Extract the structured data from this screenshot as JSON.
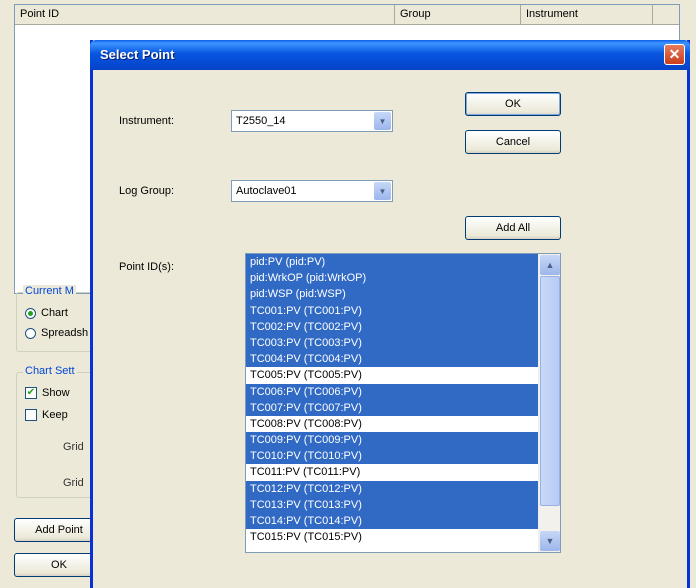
{
  "background": {
    "list_columns": [
      "Point ID",
      "Group",
      "Instrument"
    ],
    "current_mode": {
      "legend": "Current M",
      "options": [
        {
          "label": "Chart",
          "selected": true
        },
        {
          "label": "Spreadsh",
          "selected": false
        }
      ]
    },
    "chart_settings": {
      "legend": "Chart Sett",
      "checkboxes": [
        {
          "label": "Show",
          "checked": true
        },
        {
          "label": "Keep",
          "checked": false
        }
      ],
      "grid_labels": [
        "Grid",
        "Grid"
      ]
    },
    "add_point_label": "Add Point",
    "ok_label": "OK"
  },
  "dialog": {
    "title": "Select Point",
    "instrument_label": "Instrument:",
    "instrument_value": "T2550_14",
    "log_group_label": "Log Group:",
    "log_group_value": "Autoclave01",
    "point_ids_label": "Point ID(s):",
    "ok_label": "OK",
    "cancel_label": "Cancel",
    "add_all_label": "Add All",
    "close_glyph": "✕",
    "points": [
      {
        "text": "pid:PV (pid:PV)",
        "selected": true
      },
      {
        "text": "pid:WrkOP (pid:WrkOP)",
        "selected": true
      },
      {
        "text": "pid:WSP (pid:WSP)",
        "selected": true
      },
      {
        "text": "TC001:PV (TC001:PV)",
        "selected": true
      },
      {
        "text": "TC002:PV (TC002:PV)",
        "selected": true
      },
      {
        "text": "TC003:PV (TC003:PV)",
        "selected": true
      },
      {
        "text": "TC004:PV (TC004:PV)",
        "selected": true
      },
      {
        "text": "TC005:PV (TC005:PV)",
        "selected": false
      },
      {
        "text": "TC006:PV (TC006:PV)",
        "selected": true
      },
      {
        "text": "TC007:PV (TC007:PV)",
        "selected": true
      },
      {
        "text": "TC008:PV (TC008:PV)",
        "selected": false
      },
      {
        "text": "TC009:PV (TC009:PV)",
        "selected": true
      },
      {
        "text": "TC010:PV (TC010:PV)",
        "selected": true
      },
      {
        "text": "TC011:PV (TC011:PV)",
        "selected": false
      },
      {
        "text": "TC012:PV (TC012:PV)",
        "selected": true
      },
      {
        "text": "TC013:PV (TC013:PV)",
        "selected": true
      },
      {
        "text": "TC014:PV (TC014:PV)",
        "selected": true
      },
      {
        "text": "TC015:PV (TC015:PV)",
        "selected": false
      }
    ]
  }
}
